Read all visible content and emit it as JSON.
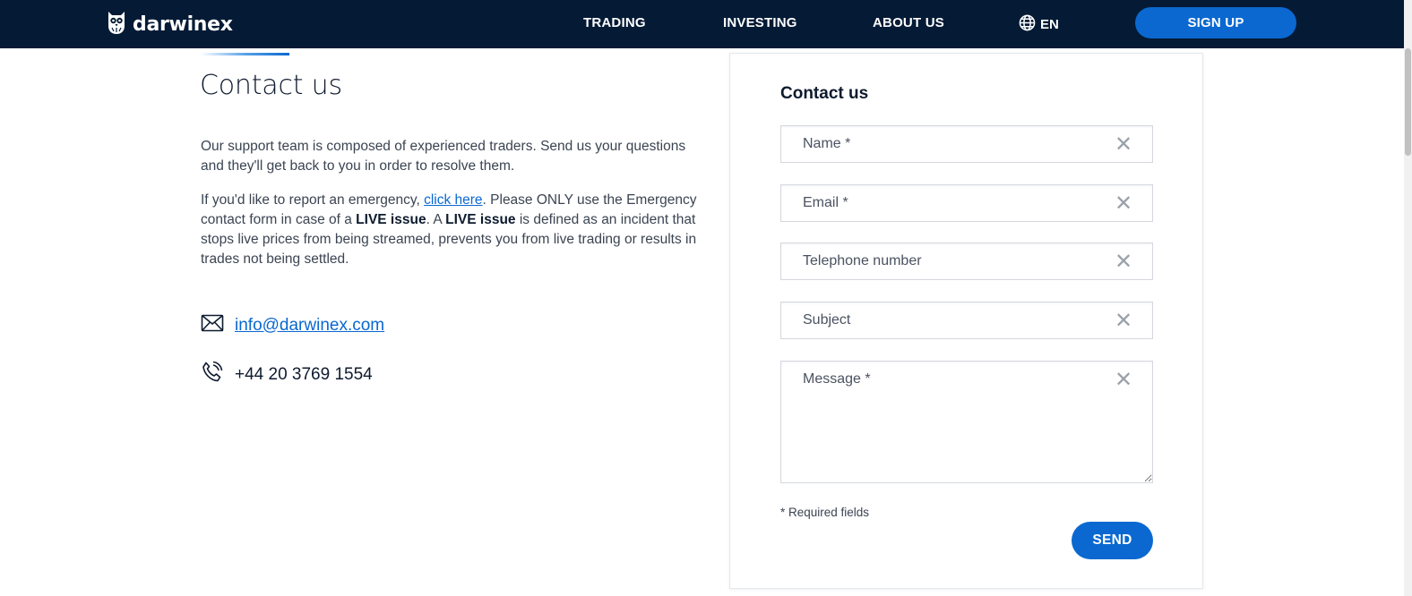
{
  "header": {
    "logo_text": "darwinex",
    "nav": {
      "trading": "TRADING",
      "investing": "INVESTING",
      "about": "ABOUT US"
    },
    "language": "EN",
    "signup_label": "SIGN UP"
  },
  "main": {
    "title": "Contact us",
    "paragraph1": "Our support team is composed of experienced traders. Send us your questions and they'll get back to you in order to resolve them.",
    "paragraph2": {
      "before_link": "If you'd like to report an emergency, ",
      "link_text": "click here",
      "after_link": ". Please ONLY use the Emergency contact form in case of a ",
      "bold1": "LIVE issue",
      "middle": ". A ",
      "bold2": "LIVE issue",
      "end": " is defined as an incident that stops live prices from being streamed, prevents you from live trading or results in trades not being settled."
    },
    "email": "info@darwinex.com",
    "phone": "+44 20 3769 1554"
  },
  "form": {
    "title": "Contact us",
    "fields": {
      "name_placeholder": "Name *",
      "email_placeholder": "Email *",
      "tel_placeholder": "Telephone number",
      "subject_placeholder": "Subject",
      "message_placeholder": "Message *"
    },
    "clear_glyph": "✕",
    "required_note": "* Required fields",
    "send_label": "SEND"
  },
  "colors": {
    "header_bg": "#041a35",
    "accent": "#0a68d0"
  }
}
